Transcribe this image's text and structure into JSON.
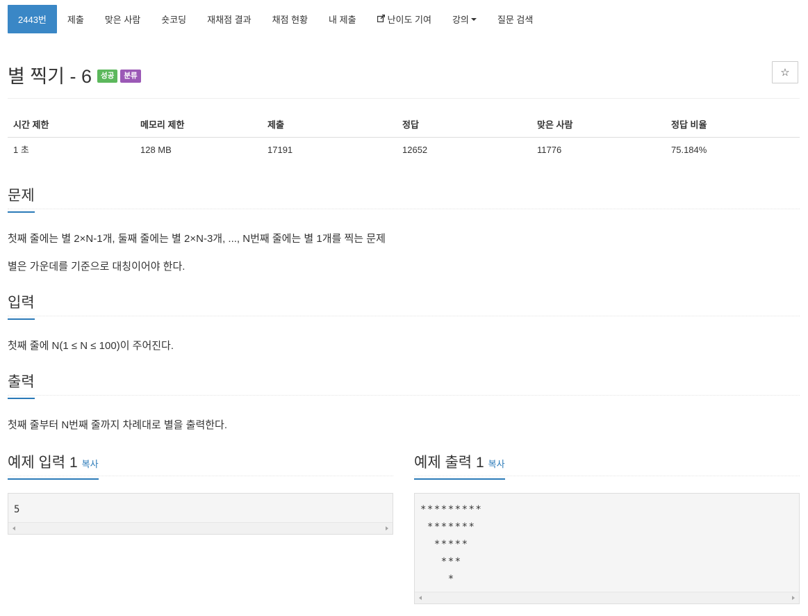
{
  "nav": {
    "items": [
      {
        "label": "2443번"
      },
      {
        "label": "제출"
      },
      {
        "label": "맞은 사람"
      },
      {
        "label": "숏코딩"
      },
      {
        "label": "재채점 결과"
      },
      {
        "label": "채점 현황"
      },
      {
        "label": "내 제출"
      },
      {
        "label": "난이도 기여"
      },
      {
        "label": "강의"
      },
      {
        "label": "질문 검색"
      }
    ]
  },
  "problem": {
    "title": "별 찍기 - 6",
    "badge_success": "성공",
    "badge_category": "분류",
    "star_icon": "☆"
  },
  "stats": {
    "headers": [
      "시간 제한",
      "메모리 제한",
      "제출",
      "정답",
      "맞은 사람",
      "정답 비율"
    ],
    "values": [
      "1 초",
      "128 MB",
      "17191",
      "12652",
      "11776",
      "75.184%"
    ]
  },
  "description": {
    "heading": "문제",
    "lines": [
      "첫째 줄에는 별 2×N-1개, 둘째 줄에는 별 2×N-3개, ..., N번째 줄에는 별 1개를 찍는 문제",
      "별은 가운데를 기준으로 대칭이어야 한다."
    ]
  },
  "input": {
    "heading": "입력",
    "text": "첫째 줄에 N(1 ≤ N ≤ 100)이 주어진다."
  },
  "output": {
    "heading": "출력",
    "text": "첫째 줄부터 N번째 줄까지 차례대로 별을 출력한다."
  },
  "sample_input": {
    "heading": "예제 입력 1",
    "copy_label": "복사",
    "content": "5"
  },
  "sample_output": {
    "heading": "예제 출력 1",
    "copy_label": "복사",
    "content": "*********\n *******\n  *****\n   ***\n    *"
  },
  "colors": {
    "accent": "#3a87c6",
    "success": "#5cb85c",
    "category": "#9b59b6",
    "link": "#2a7ab8"
  }
}
